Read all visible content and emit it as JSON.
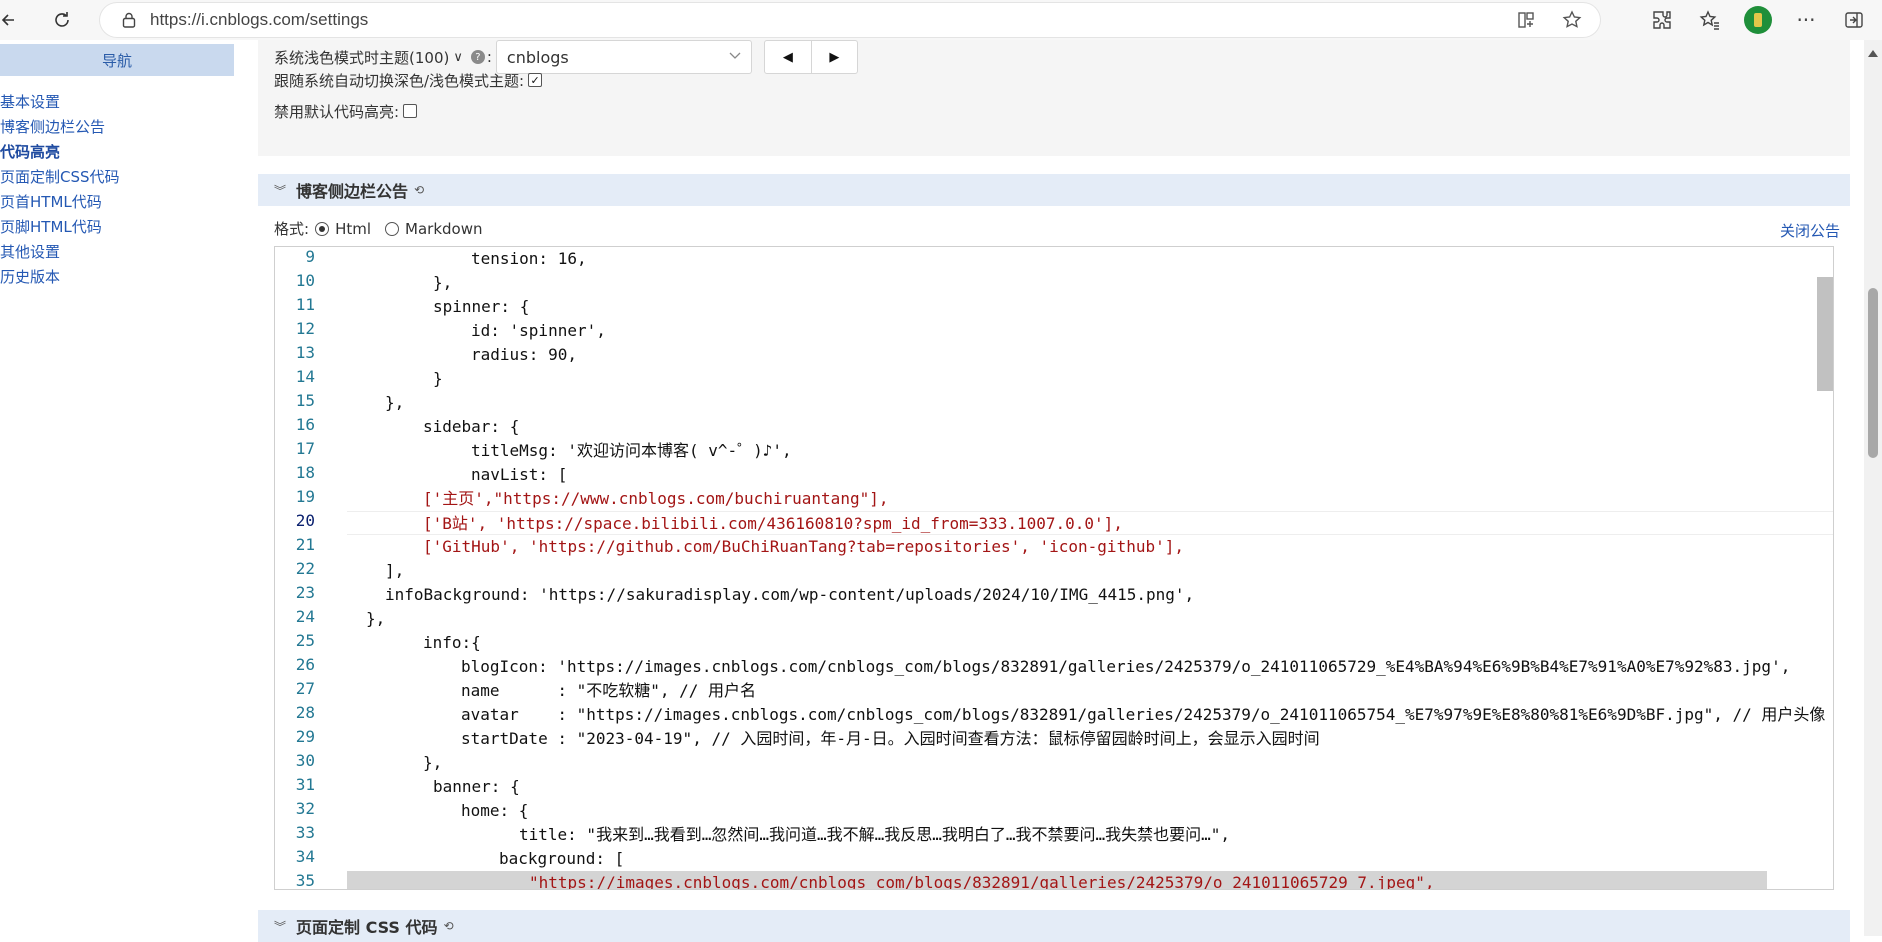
{
  "browser": {
    "url": "https://i.cnblogs.com/settings"
  },
  "nav": {
    "title": "导航",
    "items": [
      "基本设置",
      "博客侧边栏公告",
      "代码高亮",
      "页面定制CSS代码",
      "页首HTML代码",
      "页脚HTML代码",
      "其他设置",
      "历史版本"
    ],
    "active_index": 2
  },
  "settings": {
    "light_theme_label": "系统浅色模式时主题(100)",
    "light_theme_chevron": "∨",
    "light_theme_colon": ":",
    "light_theme_value": "cnblogs",
    "auto_switch_label": "跟随系统自动切换深色/浅色模式主题:",
    "auto_switch_checked": true,
    "disable_highlight_label": "禁用默认代码高亮:",
    "disable_highlight_checked": false
  },
  "sidebar_notice": {
    "title": "博客侧边栏公告",
    "format_label": "格式:",
    "format_html": "Html",
    "format_markdown": "Markdown",
    "format_selected": "Html",
    "close_link": "关闭公告"
  },
  "editor": {
    "line_numbers": [
      9,
      10,
      11,
      12,
      13,
      14,
      15,
      16,
      17,
      18,
      19,
      20,
      21,
      22,
      23,
      24,
      25,
      26,
      27,
      28,
      29,
      30,
      31,
      32,
      33,
      34,
      35
    ],
    "current_line": 20,
    "lines": [
      "tension: 16,",
      "},",
      "spinner: {",
      "id: 'spinner',",
      "radius: 90,",
      "}",
      "},",
      "sidebar: {",
      "titleMsg: '欢迎访问本博客( v^-゜)♪',",
      "navList: [",
      "['主页',\"https://www.cnblogs.com/buchiruantang\"],",
      "['B站', 'https://space.bilibili.com/436160810?spm_id_from=333.1007.0.0'],",
      "['GitHub', 'https://github.com/BuChiRuanTang?tab=repositories', 'icon-github'],",
      "],",
      "infoBackground: 'https://sakuradisplay.com/wp-content/uploads/2024/10/IMG_4415.png',",
      "},",
      "info:{",
      "blogIcon: 'https://images.cnblogs.com/cnblogs_com/blogs/832891/galleries/2425379/o_241011065729_%E4%BA%94%E6%9B%B4%E7%91%A0%E7%92%83.jpg',",
      "name      : \"不吃软糖\", // 用户名",
      "avatar    : \"https://images.cnblogs.com/cnblogs_com/blogs/832891/galleries/2425379/o_241011065754_%E7%97%9E%E8%80%81%E6%9D%BF.jpg\", // 用户头像",
      "startDate : \"2023-04-19\", // 入园时间，年-月-日。入园时间查看方法：鼠标停留园龄时间上，会显示入园时间",
      "},",
      "banner: {",
      "home: {",
      "title: \"我来到…我看到…忽然间…我问道…我不解…我反思…我明白了…我不禁要问…我失禁也要问…\",",
      "background: [",
      "\"https://images.cnblogs.com/cnblogs_com/blogs/832891/galleries/2425379/o_241011065729_7.jpeg\","
    ]
  },
  "page_css_section": {
    "title": "页面定制 CSS 代码"
  }
}
